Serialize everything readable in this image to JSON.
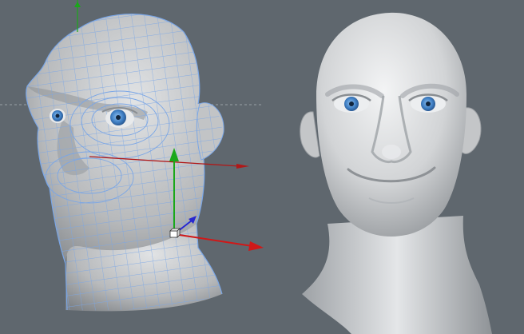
{
  "viewport": {
    "background_color": "#5f676e",
    "grid_line_color": "#9aa0a6"
  },
  "models": {
    "wireframe_head": {
      "mode": "wireframe-on-shaded",
      "shade_color": "#b7b9bb",
      "wire_color": "#7aa6e6",
      "eye_color": "#4a86c8"
    },
    "smooth_head": {
      "mode": "smooth-shaded",
      "shade_color": "#cfd1d3",
      "eye_color": "#4a86c8"
    }
  },
  "gizmo": {
    "x_axis_color": "#d01818",
    "y_axis_color": "#1aa81a",
    "z_axis_color": "#2828d0",
    "origin_icon": "cube-origin-icon"
  }
}
